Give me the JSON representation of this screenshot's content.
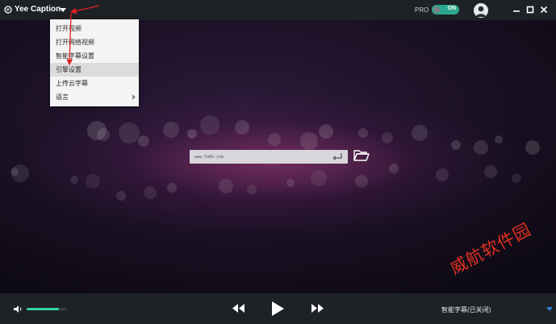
{
  "titlebar": {
    "app_title": "Yee Caption",
    "pro_label": "PRO",
    "pro_toggle_text": "ON"
  },
  "dropdown": {
    "items": [
      {
        "label": "打开视频"
      },
      {
        "label": "打开网络视频"
      },
      {
        "label": "智能字幕设置"
      },
      {
        "label": "引擎设置"
      },
      {
        "label": "上传云字幕"
      },
      {
        "label": "语言"
      }
    ],
    "active_index": 3
  },
  "stage": {
    "url_value": "www.TaDb.com"
  },
  "watermark": {
    "text": "威航软件园"
  },
  "bottombar": {
    "volume_level": 0.8,
    "status_text": "智能字幕(已关闭)"
  },
  "colors": {
    "accent": "#34d3a6",
    "toggle_on": "#2aa88d",
    "bar_bg": "#1e2226",
    "annotation": "#e02020"
  }
}
